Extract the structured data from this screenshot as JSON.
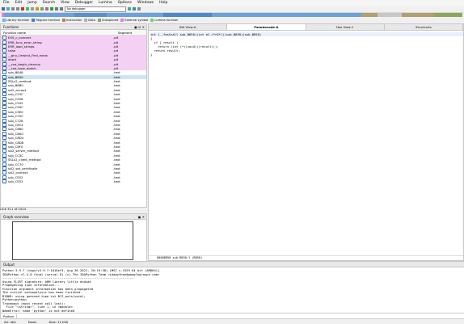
{
  "menu": [
    "File",
    "Edit",
    "Jump",
    "Search",
    "View",
    "Debugger",
    "Lumina",
    "Options",
    "Windows",
    "Help"
  ],
  "toolbar": {
    "debugger_select": "No debugger"
  },
  "legend": [
    {
      "label": "Library function",
      "color": "#6ab0f3"
    },
    {
      "label": "Regular function",
      "color": "#3e7fd6"
    },
    {
      "label": "Instruction",
      "color": "#c08050"
    },
    {
      "label": "Data",
      "color": "#b0b0b0"
    },
    {
      "label": "Unexplored",
      "color": "#8aa85e"
    },
    {
      "label": "External symbol",
      "color": "#e080e0"
    },
    {
      "label": "Lumina function",
      "color": "#6fd66f"
    }
  ],
  "functions_panel": {
    "title": "Functions",
    "col_name": "Function name",
    "col_segment": "Segment",
    "rows": [
      {
        "name": "EXS_c_connect",
        "seg": ".plt",
        "hl": true
      },
      {
        "name": "ERR_func_error_string",
        "seg": ".plt",
        "hl": true
      },
      {
        "name": "ERR_load_strings",
        "seg": ".plt",
        "hl": true
      },
      {
        "name": "raise",
        "seg": ".plt",
        "hl": true
      },
      {
        "name": "__gnu_Unwind_Find_exidx",
        "seg": ".plt",
        "hl": true
      },
      {
        "name": "abort",
        "seg": ".plt",
        "hl": true
      },
      {
        "name": "__cxa_begin_cleanup",
        "seg": ".plt",
        "hl": true
      },
      {
        "name": "__cxa_type_match",
        "seg": ".plt",
        "hl": true
      },
      {
        "name": "sub_B848",
        "seg": ".text",
        "hl": false
      },
      {
        "name": "sub_B850",
        "seg": ".text",
        "hl": false,
        "sel": true
      },
      {
        "name": "SSLv2_method",
        "seg": ".text",
        "hl": false
      },
      {
        "name": "sub_B8B0",
        "seg": ".text",
        "hl": false
      },
      {
        "name": "ssl2_accept",
        "seg": ".text",
        "hl": false
      },
      {
        "name": "sub_C23C",
        "seg": ".text",
        "hl": false
      },
      {
        "name": "sub_C528",
        "seg": ".text",
        "hl": false
      },
      {
        "name": "sub_C542",
        "seg": ".text",
        "hl": false
      },
      {
        "name": "sub_C59C",
        "seg": ".text",
        "hl": false
      },
      {
        "name": "sub_C5E0",
        "seg": ".text",
        "hl": false
      },
      {
        "name": "sub_C70C",
        "seg": ".text",
        "hl": false
      },
      {
        "name": "sub_C728",
        "seg": ".text",
        "hl": false
      },
      {
        "name": "sub_C814",
        "seg": ".text",
        "hl": false
      },
      {
        "name": "sub_C860",
        "seg": ".text",
        "hl": false
      },
      {
        "name": "sub_C8A0",
        "seg": ".text",
        "hl": false
      },
      {
        "name": "sub_C8D4",
        "seg": ".text",
        "hl": false
      },
      {
        "name": "sub_C8D8",
        "seg": ".text",
        "hl": false
      },
      {
        "name": "sub_C8F0",
        "seg": ".text",
        "hl": false
      },
      {
        "name": "ssl2_server_method",
        "seg": ".text",
        "hl": false
      },
      {
        "name": "sub_CC5C",
        "seg": ".text",
        "hl": false
      },
      {
        "name": "SSLv2_client_method",
        "seg": ".text",
        "hl": false
      },
      {
        "name": "sub_CC70",
        "seg": ".text",
        "hl": false
      },
      {
        "name": "ssl2_set_certificate",
        "seg": ".text",
        "hl": false
      },
      {
        "name": "ssl2_connect",
        "seg": ".text",
        "hl": false
      },
      {
        "name": "sub_CE52",
        "seg": ".text",
        "hl": false
      },
      {
        "name": "sub_CE53",
        "seg": ".text",
        "hl": false
      }
    ],
    "line_status": "Line 311 of 1524"
  },
  "graph_overview": {
    "title": "Graph overview"
  },
  "tabs": [
    {
      "label": "IDA View-A",
      "active": false
    },
    {
      "label": "Pseudocode-A",
      "active": true
    },
    {
      "label": "Hex View-1",
      "active": false
    },
    {
      "label": "Structures",
      "active": false
    }
  ],
  "code": [
    "int (__fastcall sub_B850)(int a1 /*r0*/)(sub_B850)(sub_B850)",
    "{",
    "  if ( result )",
    "    return (int (*)(void))(result)();",
    "  return result;",
    "}"
  ],
  "code_status": "0000B850 sub_B850:1 (B850)",
  "output_panel": {
    "title": "Output",
    "lines": [
      "Python 3.9.7 (tags/v3.9.7:1016ef3, Aug 30 2021, 20:19:38) [MSC v.1929 64 bit (AMD64)]",
      "IDAPython v7.4.0 final (serial 0) (c) The IDAPython Team <idapython@googlegroups.com>",
      "-----------------------------------------------------------------------",
      "Using FLIRT signature: ARM library little endian",
      "Propagating type information...",
      "Function argument information has been propagated",
      "The initial autoanalysis has been finished.",
      "B1B6D: using guessed type int B17_puts(void);",
      "Python>python",
      "Traceback (most recent call last):",
      "  File \"<string>\", line 1, in <module>",
      "NameError: name 'python' is not defined"
    ],
    "prompt": "Python"
  },
  "statusbar": {
    "state": "AU: idle",
    "direction": "Down",
    "disk": "Disk: 111GB"
  }
}
